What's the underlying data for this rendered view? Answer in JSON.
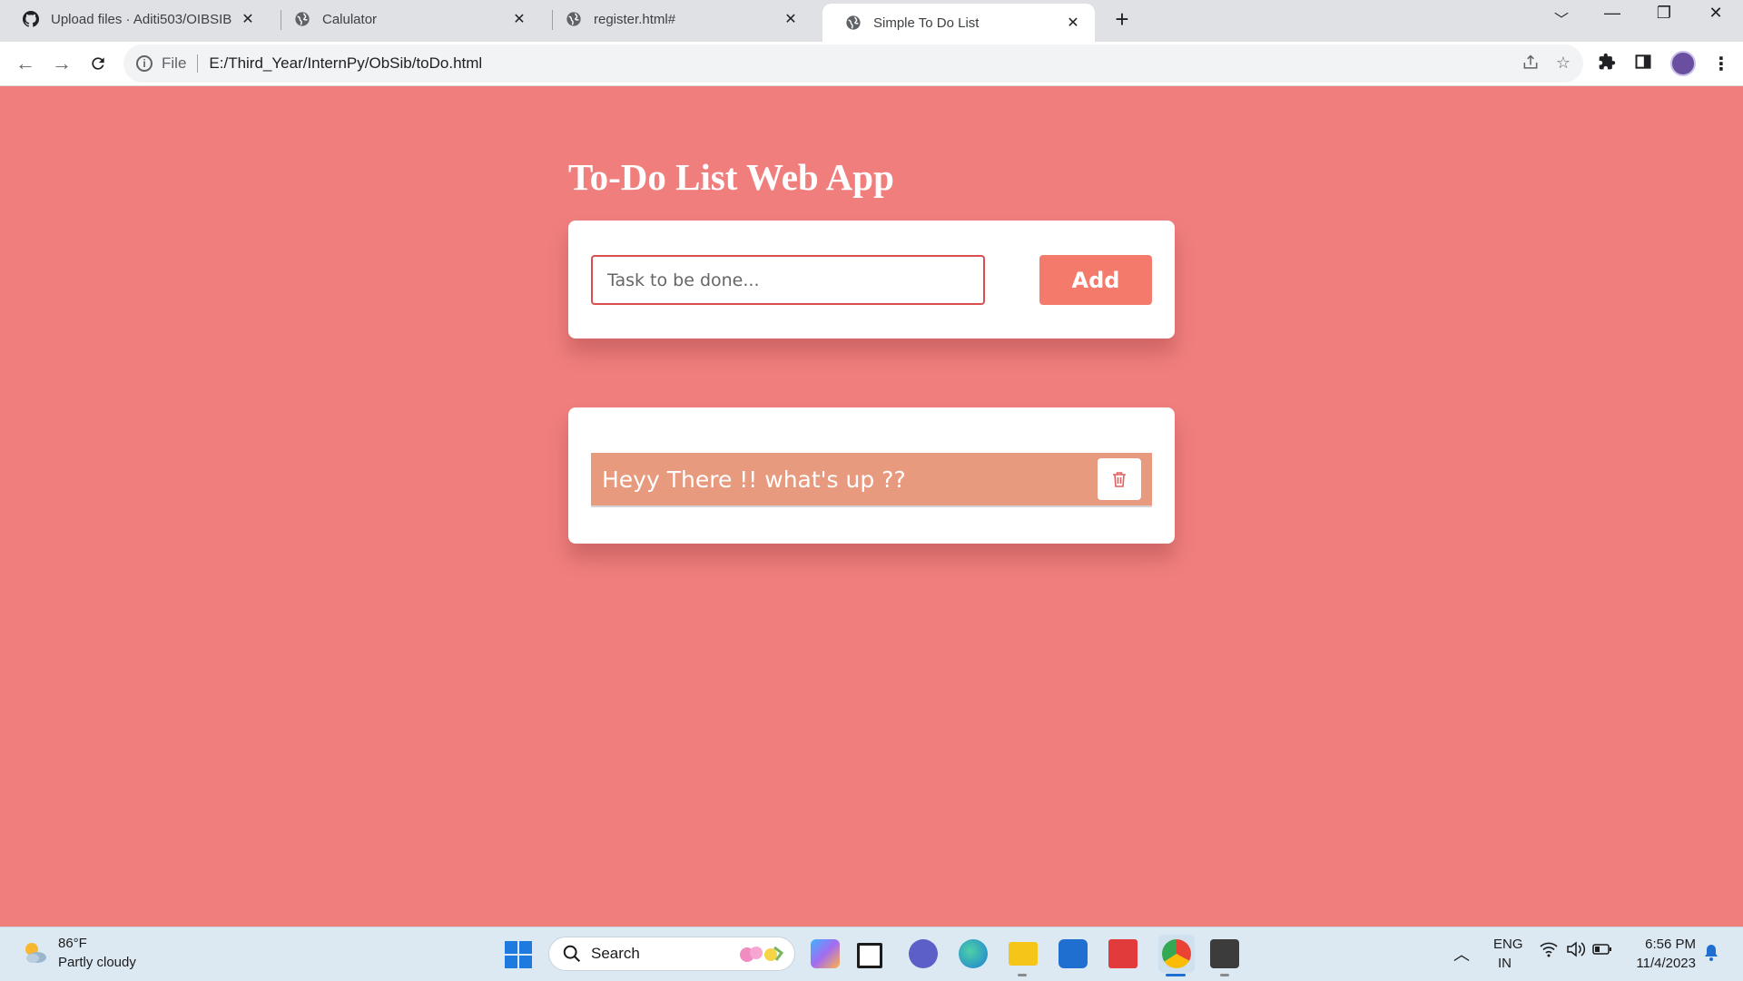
{
  "browser": {
    "tabs": [
      {
        "title": "Upload files · Aditi503/OIBSIB",
        "icon": "github-icon",
        "active": false
      },
      {
        "title": "Calulator",
        "icon": "globe-icon",
        "active": false
      },
      {
        "title": "register.html#",
        "icon": "globe-icon",
        "active": false
      },
      {
        "title": "Simple To Do List",
        "icon": "globe-icon",
        "active": true
      }
    ],
    "omnibox": {
      "scheme_label": "File",
      "url": "E:/Third_Year/InternPy/ObSib/toDo.html"
    }
  },
  "app": {
    "title": "To-Do List Web App",
    "input_placeholder": "Task to be done...",
    "add_label": "Add",
    "tasks": [
      {
        "text": "Heyy There !! what's up ??"
      }
    ]
  },
  "taskbar": {
    "weather": {
      "temp": "86°F",
      "desc": "Partly cloudy"
    },
    "search_label": "Search",
    "language": {
      "lang": "ENG",
      "region": "IN"
    },
    "clock": {
      "time": "6:56 PM",
      "date": "11/4/2023"
    }
  },
  "colors": {
    "page_background": "#f07e7d",
    "add_button": "#f47a6b",
    "task_item": "#e89a7e",
    "input_border": "#d94f4f"
  }
}
